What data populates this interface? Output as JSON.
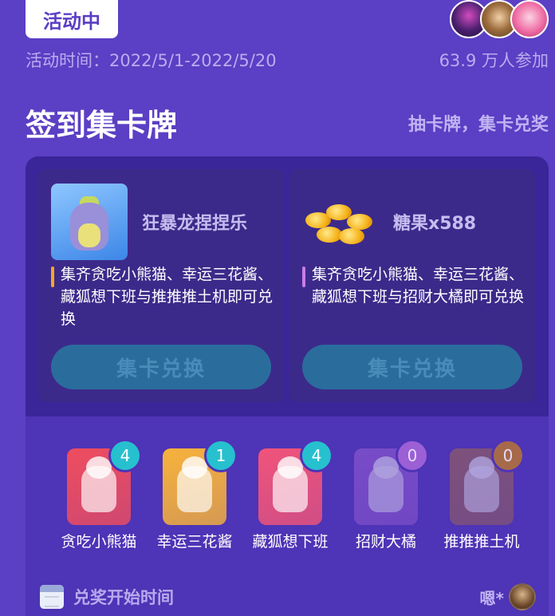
{
  "header": {
    "status_tag": "活动中",
    "event_time": "活动时间：2022/5/1-2022/5/20",
    "participants": "63.9 万人参加",
    "avatar_icons": [
      "avatar-1",
      "avatar-2",
      "avatar-3"
    ]
  },
  "section": {
    "title": "签到集卡牌",
    "subtitle": "抽卡牌，集卡兑奖"
  },
  "rewards": [
    {
      "name": "狂暴龙捏捏乐",
      "description": "集齐贪吃小熊猫、幸运三花酱、藏狐想下班与推推推土机即可兑换",
      "button_label": "集卡兑换",
      "accent_color": "#f5a623"
    },
    {
      "name": "糖果x588",
      "description": "集齐贪吃小熊猫、幸运三花酱、藏狐想下班与招财大橘即可兑换",
      "button_label": "集卡兑换",
      "accent_color": "#c77ee8"
    }
  ],
  "cards": [
    {
      "label": "贪吃小熊猫",
      "count": "4",
      "owned": true,
      "color": "#ef4d5f"
    },
    {
      "label": "幸运三花酱",
      "count": "1",
      "owned": true,
      "color": "#f7b23b"
    },
    {
      "label": "藏狐想下班",
      "count": "4",
      "owned": true,
      "color": "#f0547a"
    },
    {
      "label": "招财大橘",
      "count": "0",
      "owned": false,
      "color": "#9c5fd6"
    },
    {
      "label": "推推推土机",
      "count": "0",
      "owned": false,
      "color": "#a66a4a"
    }
  ],
  "prize": {
    "title": "兑奖开始时间",
    "user_name": "嗯*"
  }
}
